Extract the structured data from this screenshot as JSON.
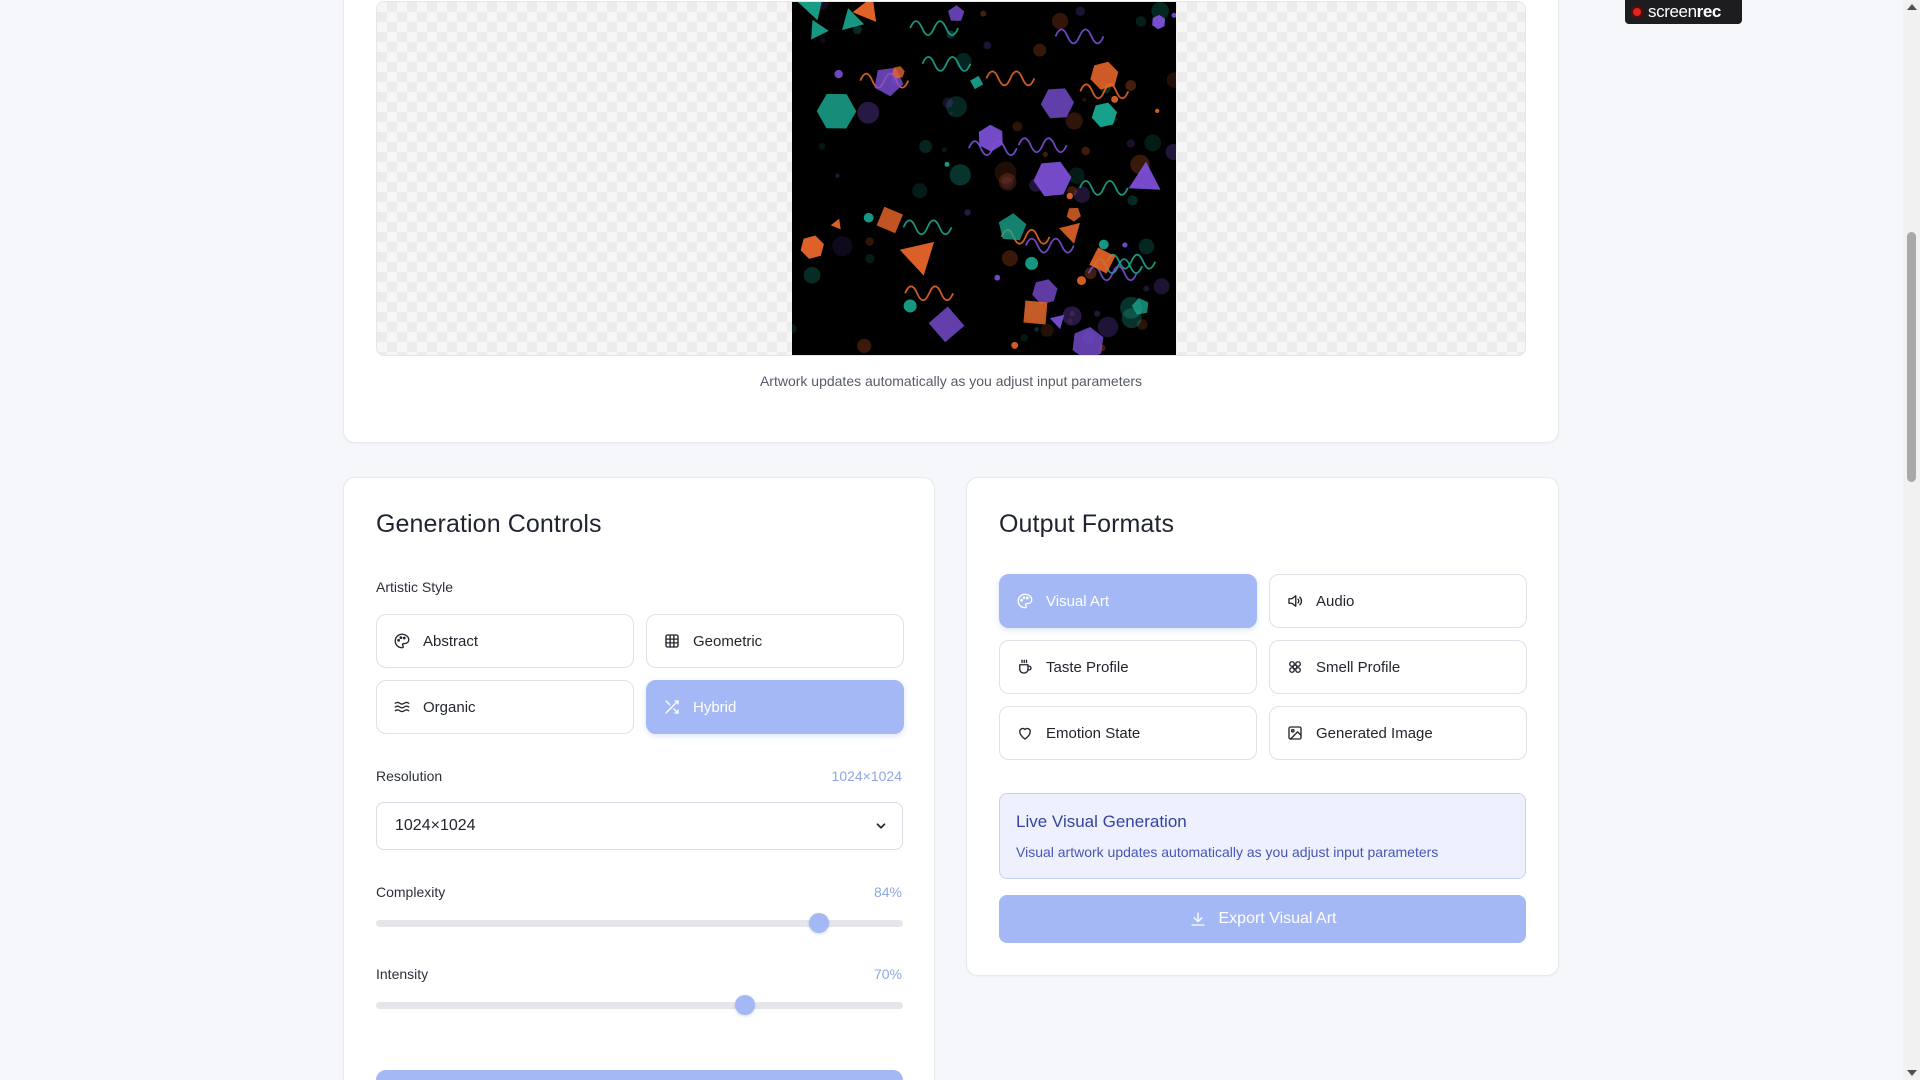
{
  "preview": {
    "caption": "Artwork updates automatically as you adjust input parameters"
  },
  "controls": {
    "title": "Generation Controls",
    "style_label": "Artistic Style",
    "styles": [
      {
        "label": "Abstract",
        "icon": "palette-icon",
        "active": false
      },
      {
        "label": "Geometric",
        "icon": "grid-icon",
        "active": false
      },
      {
        "label": "Organic",
        "icon": "waves-icon",
        "active": false
      },
      {
        "label": "Hybrid",
        "icon": "shuffle-icon",
        "active": true
      }
    ],
    "resolution_label": "Resolution",
    "resolution_value": "1024×1024",
    "resolution_selected": "1024×1024",
    "complexity_label": "Complexity",
    "complexity_value": "84%",
    "complexity_level": 0.84,
    "intensity_label": "Intensity",
    "intensity_value": "70%",
    "intensity_level": 0.7
  },
  "output": {
    "title": "Output Formats",
    "formats": [
      {
        "label": "Visual Art",
        "icon": "palette-icon",
        "active": true
      },
      {
        "label": "Audio",
        "icon": "speaker-icon",
        "active": false
      },
      {
        "label": "Taste Profile",
        "icon": "coffee-cup-icon",
        "active": false
      },
      {
        "label": "Smell Profile",
        "icon": "flower-icon",
        "active": false
      },
      {
        "label": "Emotion State",
        "icon": "heart-icon",
        "active": false
      },
      {
        "label": "Generated Image",
        "icon": "image-icon",
        "active": false
      }
    ],
    "live_title": "Live Visual Generation",
    "live_desc": "Visual artwork updates automatically as you adjust input parameters",
    "export_label": "Export Visual Art"
  },
  "recorder": {
    "brand_light": "screen",
    "brand_bold": "rec"
  },
  "colors": {
    "accent": "#a3b8f5",
    "teal": "#19a68e",
    "orange": "#e8662a",
    "purple": "#7b4fd6"
  }
}
